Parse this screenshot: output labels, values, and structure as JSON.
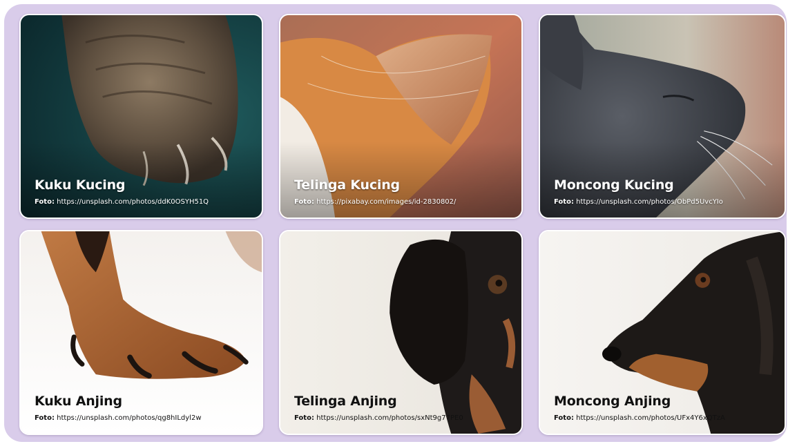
{
  "cards": [
    {
      "title": "Kuku Kucing",
      "credit_label": "Foto:",
      "credit_url": "https://unsplash.com/photos/ddK0OSYH51Q",
      "image": "cat-paw-photo"
    },
    {
      "title": "Telinga Kucing",
      "credit_label": "Foto:",
      "credit_url": "https://pixabay.com/images/id-2830802/",
      "image": "cat-ear-photo"
    },
    {
      "title": "Moncong Kucing",
      "credit_label": "Foto:",
      "credit_url": "https://unsplash.com/photos/ObPd5UvcYIo",
      "image": "cat-snout-photo"
    },
    {
      "title": "Kuku Anjing",
      "credit_label": "Foto:",
      "credit_url": "https://unsplash.com/photos/qg8hILdyl2w",
      "image": "dog-paw-photo"
    },
    {
      "title": "Telinga Anjing",
      "credit_label": "Foto:",
      "credit_url": "https://unsplash.com/photos/sxNt9g77PE0",
      "image": "dog-ear-photo"
    },
    {
      "title": "Moncong Anjing",
      "credit_label": "Foto:",
      "credit_url": "https://unsplash.com/photos/UFx4Y6xQTzA",
      "image": "dog-snout-photo"
    }
  ],
  "colors": {
    "frame": "#d9ccea",
    "card_border": "#ffffff",
    "light_text": "#ffffff",
    "dark_text": "#111111"
  }
}
